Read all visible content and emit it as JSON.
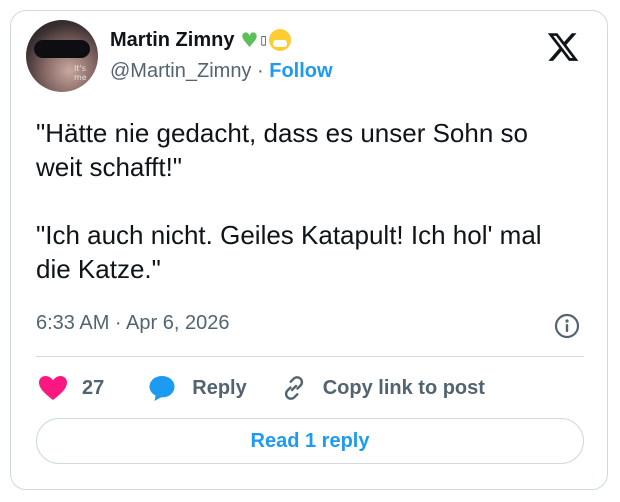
{
  "author": {
    "name": "Martin Zimny",
    "badges": [
      "green-heart-icon",
      "unknown-glyph",
      "mask-face-icon"
    ],
    "badge_glyph": "▯",
    "handle": "@Martin_Zimny",
    "separator": "·",
    "follow_label": "Follow",
    "avatar_text": "It's\nme"
  },
  "brand": {
    "logo": "x-logo-icon",
    "accent_color": "#1d9bf0",
    "like_color": "#f91880"
  },
  "tweet": {
    "text": "\"Hätte nie gedacht, dass es unser Sohn so weit schafft!\"\n\n\"Ich auch nicht. Geiles Katapult! Ich hol' mal die Katze.\"",
    "time": "6:33 AM · Apr 6, 2026"
  },
  "actions": {
    "like_count": "27",
    "reply_label": "Reply",
    "copy_label": "Copy link to post"
  },
  "replies": {
    "read_label": "Read 1 reply"
  }
}
